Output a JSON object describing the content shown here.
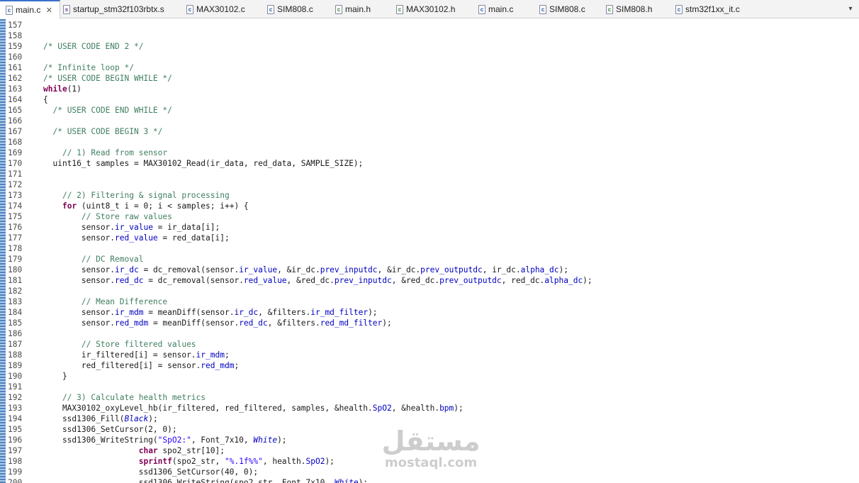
{
  "tabs": [
    {
      "label": "main.c",
      "icon": "c-file-icon",
      "active": true,
      "closable": true
    },
    {
      "label": "startup_stm32f103rbtx.s",
      "icon": "asm-file-icon"
    },
    {
      "label": "MAX30102.c",
      "icon": "c-file-icon"
    },
    {
      "label": "SIM808.c",
      "icon": "c-file-icon"
    },
    {
      "label": "main.h",
      "icon": "h-file-icon"
    },
    {
      "label": "MAX30102.h",
      "icon": "h-file-icon"
    },
    {
      "label": "main.c",
      "icon": "c-file-icon"
    },
    {
      "label": "SIM808.c",
      "icon": "c-file-icon"
    },
    {
      "label": "SIM808.h",
      "icon": "h-file-icon"
    },
    {
      "label": "stm32f1xx_it.c",
      "icon": "c-file-icon"
    }
  ],
  "tab_menu_icon": "chevron-down-icon",
  "colors": {
    "comment": "#3f7f5f",
    "keyword": "#7f0055",
    "field": "#0000c0",
    "string": "#2a00ff",
    "active_tab_accent": "#3a70c8"
  },
  "code": {
    "first_line": 157,
    "lines": [
      [],
      [],
      [
        [
          "cm",
          "/* USER CODE END 2 */"
        ]
      ],
      [],
      [
        [
          "cm",
          "/* Infinite loop */"
        ]
      ],
      [
        [
          "cm",
          "/* USER CODE BEGIN WHILE */"
        ]
      ],
      [
        [
          "kw",
          "while"
        ],
        [
          "",
          "(1)"
        ]
      ],
      [
        [
          "",
          "{"
        ]
      ],
      [
        [
          "",
          "  "
        ],
        [
          "cm",
          "/* USER CODE END WHILE */"
        ]
      ],
      [],
      [
        [
          "",
          "  "
        ],
        [
          "cm",
          "/* USER CODE BEGIN 3 */"
        ]
      ],
      [],
      [
        [
          "",
          "    "
        ],
        [
          "cm",
          "// 1) Read from sensor"
        ]
      ],
      [
        [
          "",
          "  uint16_t samples = MAX30102_Read(ir_data, red_data, SAMPLE_SIZE);"
        ]
      ],
      [],
      [],
      [
        [
          "",
          "    "
        ],
        [
          "cm",
          "// 2) Filtering & signal processing"
        ]
      ],
      [
        [
          "",
          "    "
        ],
        [
          "kw",
          "for"
        ],
        [
          "",
          " (uint8_t i = 0; i < samples; i++) {"
        ]
      ],
      [
        [
          "",
          "        "
        ],
        [
          "cm",
          "// Store raw values"
        ]
      ],
      [
        [
          "",
          "        sensor."
        ],
        [
          "fld",
          "ir_value"
        ],
        [
          "",
          " = ir_data[i];"
        ]
      ],
      [
        [
          "",
          "        sensor."
        ],
        [
          "fld",
          "red_value"
        ],
        [
          "",
          " = red_data[i];"
        ]
      ],
      [],
      [
        [
          "",
          "        "
        ],
        [
          "cm",
          "// DC Removal"
        ]
      ],
      [
        [
          "",
          "        sensor."
        ],
        [
          "fld",
          "ir_dc"
        ],
        [
          "",
          " = dc_removal(sensor."
        ],
        [
          "fld",
          "ir_value"
        ],
        [
          "",
          ", &ir_dc."
        ],
        [
          "fld",
          "prev_inputdc"
        ],
        [
          "",
          ", &ir_dc."
        ],
        [
          "fld",
          "prev_outputdc"
        ],
        [
          "",
          ", ir_dc."
        ],
        [
          "fld",
          "alpha_dc"
        ],
        [
          "",
          ");"
        ]
      ],
      [
        [
          "",
          "        sensor."
        ],
        [
          "fld",
          "red_dc"
        ],
        [
          "",
          " = dc_removal(sensor."
        ],
        [
          "fld",
          "red_value"
        ],
        [
          "",
          ", &red_dc."
        ],
        [
          "fld",
          "prev_inputdc"
        ],
        [
          "",
          ", &red_dc."
        ],
        [
          "fld",
          "prev_outputdc"
        ],
        [
          "",
          ", red_dc."
        ],
        [
          "fld",
          "alpha_dc"
        ],
        [
          "",
          ");"
        ]
      ],
      [],
      [
        [
          "",
          "        "
        ],
        [
          "cm",
          "// Mean Difference"
        ]
      ],
      [
        [
          "",
          "        sensor."
        ],
        [
          "fld",
          "ir_mdm"
        ],
        [
          "",
          " = meanDiff(sensor."
        ],
        [
          "fld",
          "ir_dc"
        ],
        [
          "",
          ", &filters."
        ],
        [
          "fld",
          "ir_md_filter"
        ],
        [
          "",
          ");"
        ]
      ],
      [
        [
          "",
          "        sensor."
        ],
        [
          "fld",
          "red_mdm"
        ],
        [
          "",
          " = meanDiff(sensor."
        ],
        [
          "fld",
          "red_dc"
        ],
        [
          "",
          ", &filters."
        ],
        [
          "fld",
          "red_md_filter"
        ],
        [
          "",
          ");"
        ]
      ],
      [],
      [
        [
          "",
          "        "
        ],
        [
          "cm",
          "// Store filtered values"
        ]
      ],
      [
        [
          "",
          "        ir_filtered[i] = sensor."
        ],
        [
          "fld",
          "ir_mdm"
        ],
        [
          "",
          ";"
        ]
      ],
      [
        [
          "",
          "        red_filtered[i] = sensor."
        ],
        [
          "fld",
          "red_mdm"
        ],
        [
          "",
          ";"
        ]
      ],
      [
        [
          "",
          "    }"
        ]
      ],
      [],
      [
        [
          "",
          "    "
        ],
        [
          "cm",
          "// 3) Calculate health metrics"
        ]
      ],
      [
        [
          "",
          "    MAX30102_oxyLevel_hb(ir_filtered, red_filtered, samples, &health."
        ],
        [
          "fld",
          "SpO2"
        ],
        [
          "",
          ", &health."
        ],
        [
          "fld",
          "bpm"
        ],
        [
          "",
          ");"
        ]
      ],
      [
        [
          "",
          "    ssd1306_Fill("
        ],
        [
          "itl",
          "Black"
        ],
        [
          "",
          ");"
        ]
      ],
      [
        [
          "",
          "    ssd1306_SetCursor(2, 0);"
        ]
      ],
      [
        [
          "",
          "    ssd1306_WriteString("
        ],
        [
          "str",
          "\"SpO2:\""
        ],
        [
          "",
          ", Font_7x10, "
        ],
        [
          "itl",
          "White"
        ],
        [
          "",
          ");"
        ]
      ],
      [
        [
          "",
          "                    "
        ],
        [
          "kw",
          "char"
        ],
        [
          "",
          " spo2_str[10];"
        ]
      ],
      [
        [
          "",
          "                    "
        ],
        [
          "kw",
          "sprintf"
        ],
        [
          "",
          "(spo2_str, "
        ],
        [
          "str",
          "\"%.1f%%\""
        ],
        [
          "",
          ", health."
        ],
        [
          "fld",
          "SpO2"
        ],
        [
          "",
          ");"
        ]
      ],
      [
        [
          "",
          "                    ssd1306_SetCursor(40, 0);"
        ]
      ],
      [
        [
          "",
          "                    ssd1306_WriteString(spo2_str, Font_7x10, "
        ],
        [
          "itl",
          "White"
        ],
        [
          "",
          ");"
        ]
      ]
    ]
  },
  "watermark": {
    "arabic": "مستقل",
    "latin": "mostaql.com"
  }
}
